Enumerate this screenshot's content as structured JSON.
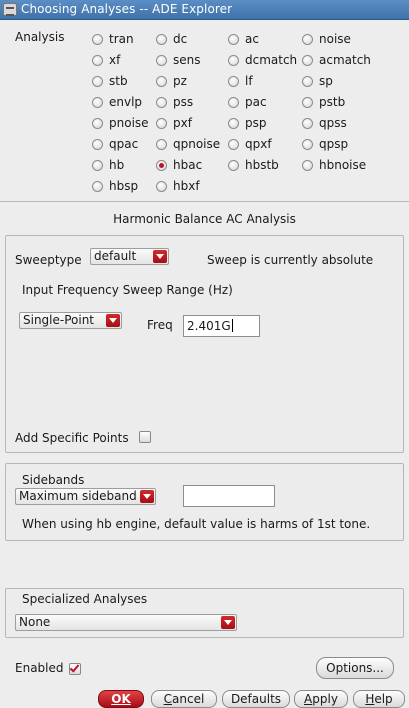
{
  "window": {
    "title": "Choosing Analyses -- ADE Explorer"
  },
  "analysis": {
    "label": "Analysis",
    "options": [
      [
        "tran",
        "dc",
        "ac",
        "noise"
      ],
      [
        "xf",
        "sens",
        "dcmatch",
        "acmatch"
      ],
      [
        "stb",
        "pz",
        "lf",
        "sp"
      ],
      [
        "envlp",
        "pss",
        "pac",
        "pstb"
      ],
      [
        "pnoise",
        "pxf",
        "psp",
        "qpss"
      ],
      [
        "qpac",
        "qpnoise",
        "qpxf",
        "qpsp"
      ],
      [
        "hb",
        "hbac",
        "hbstb",
        "hbnoise"
      ],
      [
        "hbsp",
        "hbxf"
      ]
    ],
    "selected": "hbac"
  },
  "section_title": "Harmonic Balance AC Analysis",
  "sweep": {
    "sweeptype_label": "Sweeptype",
    "sweeptype_value": "default",
    "status": "Sweep is currently absolute",
    "range_label": "Input Frequency Sweep Range (Hz)",
    "range_mode": "Single-Point",
    "freq_label": "Freq",
    "freq_value": "2.401G",
    "add_points_label": "Add Specific Points",
    "add_points_checked": false
  },
  "sidebands": {
    "label": "Sidebands",
    "mode": "Maximum sideband",
    "value": "",
    "note": "When using hb engine, default value is harms of 1st tone."
  },
  "specialized": {
    "label": "Specialized Analyses",
    "value": "None"
  },
  "enabled": {
    "label": "Enabled",
    "checked": true
  },
  "buttons": {
    "options": "Options...",
    "ok": "OK",
    "cancel": "Cancel",
    "defaults": "Defaults",
    "apply": "Apply",
    "help": "Help"
  },
  "colors": {
    "accent": "#c0102a",
    "titlebar": "#4a7fb8"
  }
}
